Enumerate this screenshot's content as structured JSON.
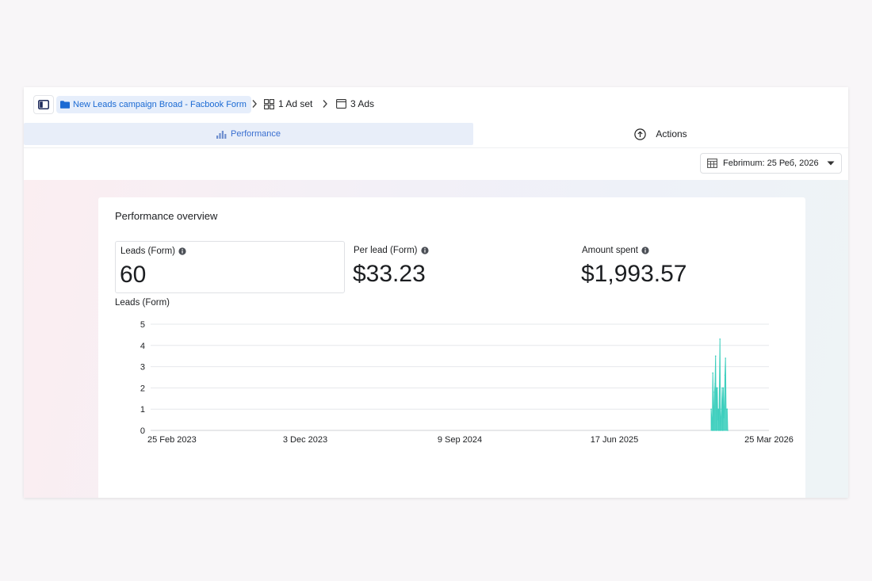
{
  "breadcrumb": {
    "campaign": "New Leads campaign Broad - Facbook Form",
    "adset": "1 Ad set",
    "ads": "3 Ads"
  },
  "tabs": {
    "performance": "Performance",
    "actions": "Actions"
  },
  "date_filter": {
    "label": "Febrimum: 25 Реб, 2026"
  },
  "overview": {
    "title": "Performance overview",
    "metrics": [
      {
        "label": "Leads (Form)",
        "value": "60"
      },
      {
        "label": "Per lead (Form)",
        "value": "$33.23"
      },
      {
        "label": "Amount spent",
        "value": "$1,993.57"
      }
    ],
    "chart_title": "Leads (Form)"
  },
  "colors": {
    "accent": "#1b6ad3",
    "series": "#3ecfbe"
  },
  "chart_data": {
    "type": "area",
    "title": "Leads (Form)",
    "xlabel": "",
    "ylabel": "",
    "ylim": [
      0,
      5
    ],
    "xlim": [
      "2023-02-25",
      "2026-03-25"
    ],
    "y_ticks": [
      "0",
      "1",
      "2",
      "3",
      "4",
      "5"
    ],
    "x_ticks": [
      {
        "date": "2023-02-25",
        "label": "25 Feb 2023"
      },
      {
        "date": "2023-12-03",
        "label": "3 Dec 2023"
      },
      {
        "date": "2024-09-09",
        "label": "9 Sep 2024"
      },
      {
        "date": "2025-06-17",
        "label": "17 Jun 2025"
      },
      {
        "date": "2026-03-25",
        "label": "25 Mar 2026"
      }
    ],
    "grid": true,
    "legend": "none",
    "series": [
      {
        "points": [
          [
            "2025-12-10",
            1
          ],
          [
            "2025-12-12",
            0
          ],
          [
            "2025-12-13",
            2.7
          ],
          [
            "2025-12-15",
            0
          ],
          [
            "2025-12-16",
            1.8
          ],
          [
            "2025-12-17",
            2.2
          ],
          [
            "2025-12-18",
            3.5
          ],
          [
            "2025-12-19",
            0
          ],
          [
            "2025-12-20",
            2
          ],
          [
            "2025-12-21",
            2
          ],
          [
            "2025-12-22",
            0.5
          ],
          [
            "2025-12-23",
            1
          ],
          [
            "2025-12-24",
            0
          ],
          [
            "2025-12-26",
            4.3
          ],
          [
            "2025-12-27",
            0
          ],
          [
            "2025-12-29",
            1
          ],
          [
            "2025-12-30",
            2
          ],
          [
            "2025-12-31",
            0
          ],
          [
            "2026-01-01",
            2
          ],
          [
            "2026-01-02",
            0.6
          ],
          [
            "2026-01-03",
            1
          ],
          [
            "2026-01-04",
            2.6
          ],
          [
            "2026-01-05",
            3.4
          ],
          [
            "2026-01-06",
            1
          ],
          [
            "2026-01-08",
            1
          ],
          [
            "2026-01-09",
            0
          ]
        ]
      }
    ]
  }
}
